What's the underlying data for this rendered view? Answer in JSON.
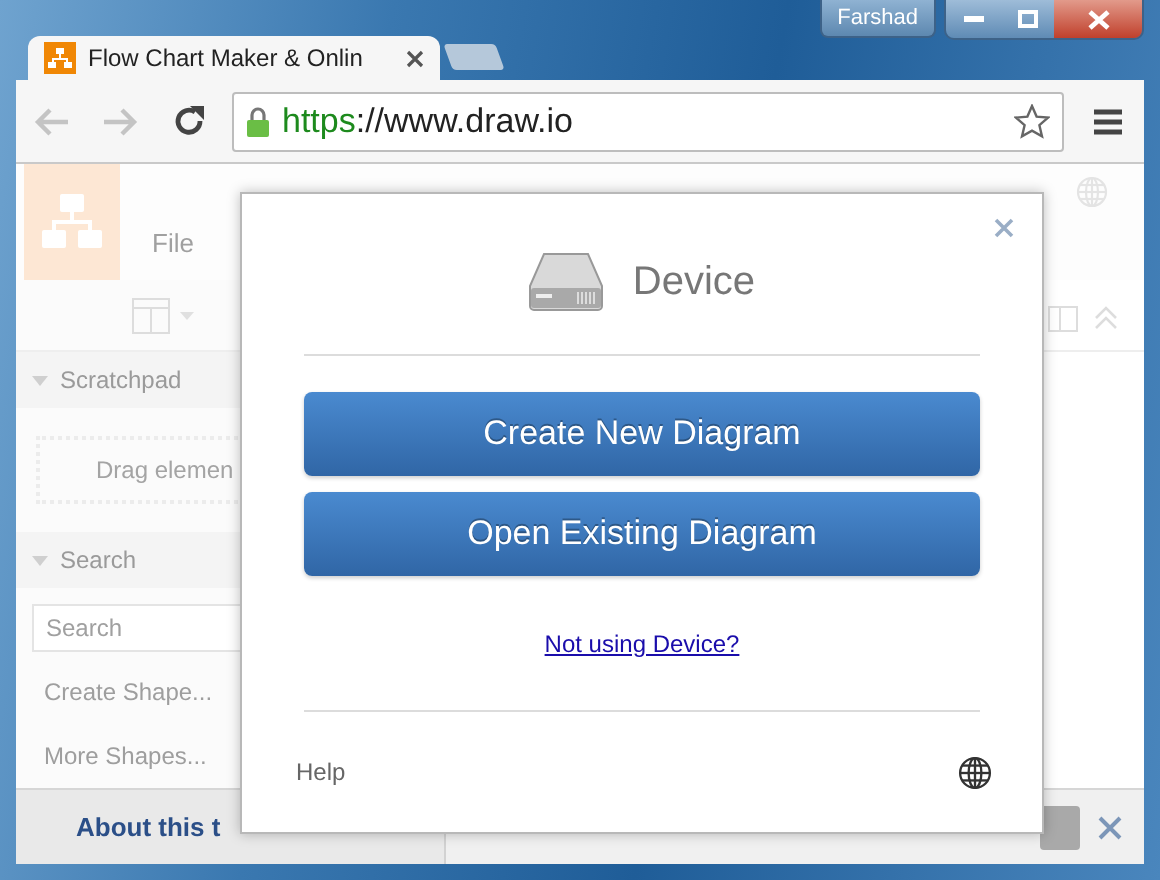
{
  "window": {
    "user": "Farshad"
  },
  "tabs": [
    {
      "title": "Flow Chart Maker & Onlin",
      "selected": true
    }
  ],
  "address_bar": {
    "scheme": "https",
    "rest": "://www.draw.io",
    "secure": true
  },
  "app": {
    "menu": [
      "File"
    ],
    "sidebar": {
      "sections": [
        {
          "title": "Scratchpad",
          "expanded": true,
          "hint": "Drag elemen"
        },
        {
          "title": "Search",
          "expanded": true,
          "placeholder": "Search"
        }
      ],
      "links": [
        "Create Shape...",
        "More Shapes..."
      ]
    },
    "footer": {
      "title": "About this t"
    }
  },
  "dialog": {
    "title": "Device",
    "buttons": [
      "Create New Diagram",
      "Open Existing Diagram"
    ],
    "link": "Not using Device?",
    "help": "Help"
  }
}
